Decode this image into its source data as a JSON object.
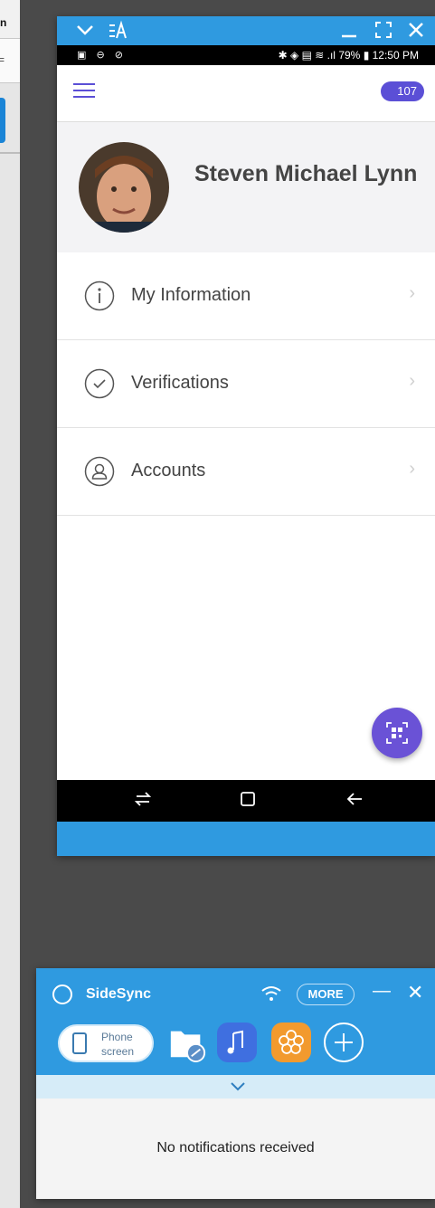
{
  "left_window": {
    "row1_text": "n",
    "row2_text": "="
  },
  "phone_window": {
    "titlebar": {
      "chevron_icon": "chevron-down-icon",
      "resize_icon": "resize-icon",
      "minimize_icon": "minimize-icon",
      "fullscreen_icon": "fullscreen-icon",
      "close_icon": "close-icon"
    },
    "status_bar": {
      "left_icons": "▣ ⊖ ⊘",
      "battery_percent": "79%",
      "time": "12:50 PM"
    },
    "app_bar": {
      "badge_value": "107"
    },
    "profile": {
      "name": "Steven Michael Lynn"
    },
    "menu_items": [
      {
        "label": "My Information",
        "icon": "info-icon"
      },
      {
        "label": "Verifications",
        "icon": "check-icon"
      },
      {
        "label": "Accounts",
        "icon": "user-icon"
      }
    ],
    "fab_icon": "qr-code-icon",
    "nav_bar": {
      "recents_icon": "recents-icon",
      "home_icon": "home-icon",
      "back_icon": "back-icon"
    }
  },
  "sidesync": {
    "title": "SideSync",
    "more_label": "MORE",
    "phone_screen_label_1": "Phone",
    "phone_screen_label_2": "screen",
    "apps": [
      {
        "name": "file-transfer-icon",
        "color": "#5b8fc8"
      },
      {
        "name": "music-icon",
        "color": "#3f6fe0"
      },
      {
        "name": "gallery-icon",
        "color": "#f29a2e"
      }
    ],
    "empty_message": "No notifications received",
    "accent_color": "#2f9ae0"
  }
}
